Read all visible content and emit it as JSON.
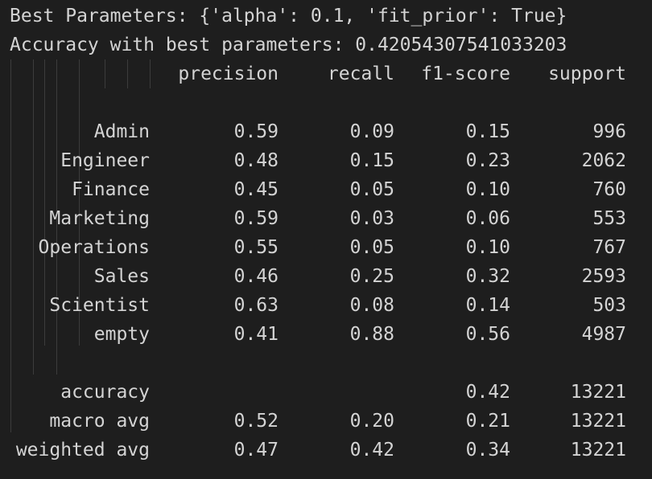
{
  "output": {
    "best_params_line": "Best Parameters: {'alpha': 0.1, 'fit_prior': True}",
    "accuracy_line": "Accuracy with best parameters: 0.42054307541033203"
  },
  "report": {
    "headers": [
      "precision",
      "recall",
      "f1-score",
      "support"
    ],
    "rows": [
      {
        "label": "Admin",
        "precision": "0.59",
        "recall": "0.09",
        "f1": "0.15",
        "support": "996"
      },
      {
        "label": "Engineer",
        "precision": "0.48",
        "recall": "0.15",
        "f1": "0.23",
        "support": "2062"
      },
      {
        "label": "Finance",
        "precision": "0.45",
        "recall": "0.05",
        "f1": "0.10",
        "support": "760"
      },
      {
        "label": "Marketing",
        "precision": "0.59",
        "recall": "0.03",
        "f1": "0.06",
        "support": "553"
      },
      {
        "label": "Operations",
        "precision": "0.55",
        "recall": "0.05",
        "f1": "0.10",
        "support": "767"
      },
      {
        "label": "Sales",
        "precision": "0.46",
        "recall": "0.25",
        "f1": "0.32",
        "support": "2593"
      },
      {
        "label": "Scientist",
        "precision": "0.63",
        "recall": "0.08",
        "f1": "0.14",
        "support": "503"
      },
      {
        "label": "empty",
        "precision": "0.41",
        "recall": "0.88",
        "f1": "0.56",
        "support": "4987"
      }
    ],
    "summary": [
      {
        "label": "accuracy",
        "precision": "",
        "recall": "",
        "f1": "0.42",
        "support": "13221"
      },
      {
        "label": "macro avg",
        "precision": "0.52",
        "recall": "0.20",
        "f1": "0.21",
        "support": "13221"
      },
      {
        "label": "weighted avg",
        "precision": "0.47",
        "recall": "0.42",
        "f1": "0.34",
        "support": "13221"
      }
    ]
  }
}
